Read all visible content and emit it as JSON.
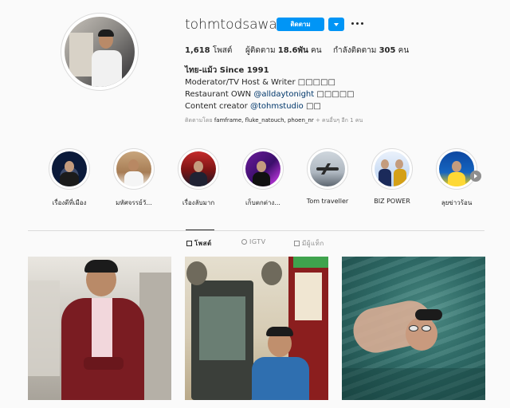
{
  "profile": {
    "username": "tohmtodsawat",
    "follow_label": "ติดตาม",
    "posts_count": "1,618",
    "posts_label": "โพสต์",
    "followers_label": "ผู้ติดตาม",
    "followers_count": "18.6พัน",
    "followers_unit": "คน",
    "following_label": "กำลังติดตาม",
    "following_count": "305",
    "following_unit": "คน"
  },
  "bio": {
    "name": "ไทย-แม้ว Since 1991",
    "line1": "Moderator/TV Host & Writer □□□□□",
    "line2_prefix": "Restaurant OWN ",
    "line2_link": "@alldaytonight",
    "line2_suffix": " □□□□□",
    "line3_prefix": "Content creator ",
    "line3_link": "@tohmstudio",
    "line3_suffix": " □□"
  },
  "followed_by": {
    "prefix": "ติดตามโดย ",
    "names": "famframe, fluke_natouch, phoen_nr",
    "suffix": " + คนอื่นๆ อีก 1 คน"
  },
  "highlights": [
    {
      "label": "เรื่องดีที่เมือง",
      "icon": "news-anchor-image"
    },
    {
      "label": "มหัศจรรย์วั...",
      "icon": "host-portrait-image"
    },
    {
      "label": "เรื่องลับมาก",
      "icon": "studio-set-image"
    },
    {
      "label": "เก็บตกต่าง...",
      "icon": "event-stage-image"
    },
    {
      "label": "Tom traveller",
      "icon": "airplane-image"
    },
    {
      "label": "BIZ POWER",
      "icon": "biz-power-image"
    },
    {
      "label": "ลุยข่าวร้อน",
      "icon": "hot-news-image"
    }
  ],
  "tabs": [
    {
      "label": "โพสต์",
      "active": true,
      "icon": "grid-icon"
    },
    {
      "label": "IGTV",
      "active": false,
      "icon": "tv-icon"
    },
    {
      "label": "มีผู้แท็ก",
      "active": false,
      "icon": "tag-icon"
    }
  ],
  "posts": [
    {
      "description_icon": "man-in-red-blazer-photo"
    },
    {
      "description_icon": "man-by-antique-cabinet-photo"
    },
    {
      "description_icon": "man-swimming-photo"
    }
  ],
  "colors": {
    "accent": "#0095f6",
    "link": "#00376b",
    "muted": "#8e8e8e",
    "text": "#262626"
  }
}
